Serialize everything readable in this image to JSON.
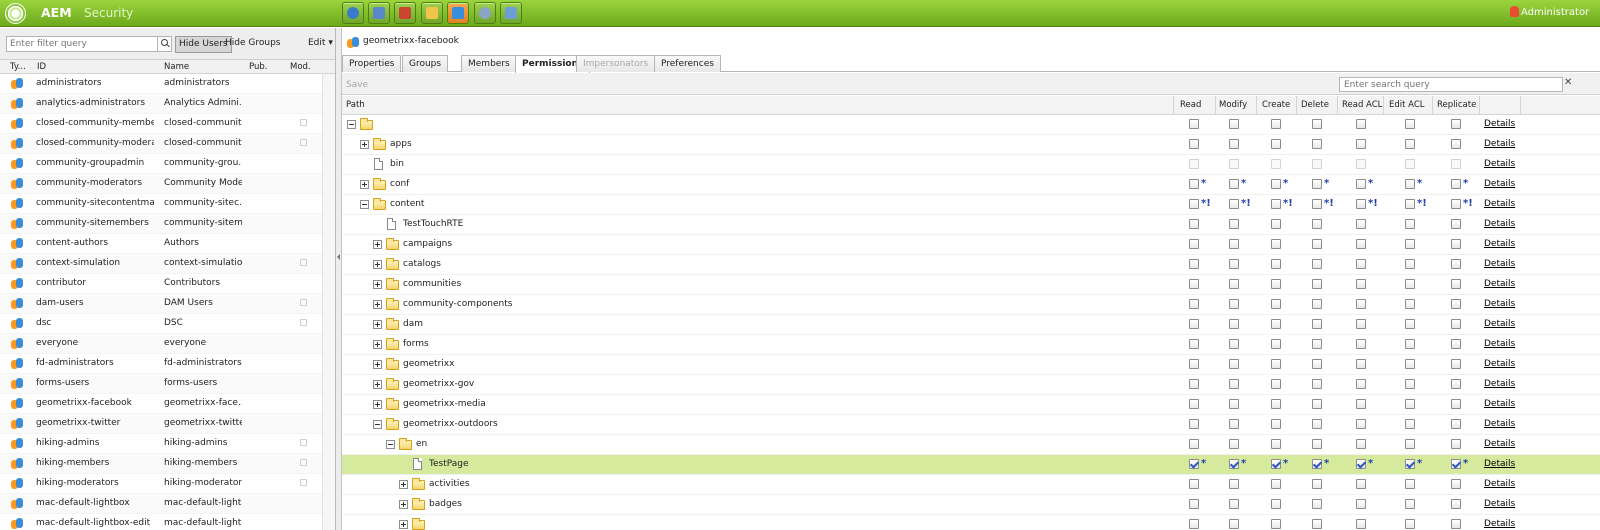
{
  "app": {
    "brand": "AEM",
    "section": "Security",
    "user": "Administrator"
  },
  "toolbar_icons": [
    "websites-icon",
    "digital-assets-icon",
    "campaigns-icon",
    "inbox-icon",
    "users-icon",
    "tools-icon",
    "tagging-icon"
  ],
  "left": {
    "filter_placeholder": "Enter filter query",
    "hide_users": "Hide Users",
    "hide_groups": "Hide Groups",
    "edit": "Edit",
    "columns": [
      "Ty...",
      "ID",
      "Name",
      "Pub.",
      "Mod."
    ],
    "rows": [
      {
        "id": "administrators",
        "name": "administrators",
        "mod": false
      },
      {
        "id": "analytics-administrators",
        "name": "Analytics Admini...",
        "mod": false
      },
      {
        "id": "closed-community-members",
        "name": "closed-communit...",
        "mod": true
      },
      {
        "id": "closed-community-moderat...",
        "name": "closed-communit...",
        "mod": true
      },
      {
        "id": "community-groupadmin",
        "name": "community-grou...",
        "mod": false
      },
      {
        "id": "community-moderators",
        "name": "Community Mode...",
        "mod": false
      },
      {
        "id": "community-sitecontentman...",
        "name": "community-sitec...",
        "mod": false
      },
      {
        "id": "community-sitemembers",
        "name": "community-sitem...",
        "mod": false
      },
      {
        "id": "content-authors",
        "name": "Authors",
        "mod": false
      },
      {
        "id": "context-simulation",
        "name": "context-simulation",
        "mod": true
      },
      {
        "id": "contributor",
        "name": "Contributors",
        "mod": false
      },
      {
        "id": "dam-users",
        "name": "DAM Users",
        "mod": true
      },
      {
        "id": "dsc",
        "name": "DSC",
        "mod": true
      },
      {
        "id": "everyone",
        "name": "everyone",
        "mod": false
      },
      {
        "id": "fd-administrators",
        "name": "fd-administrators",
        "mod": false
      },
      {
        "id": "forms-users",
        "name": "forms-users",
        "mod": false
      },
      {
        "id": "geometrixx-facebook",
        "name": "geometrixx-face...",
        "mod": false
      },
      {
        "id": "geometrixx-twitter",
        "name": "geometrixx-twitter",
        "mod": false
      },
      {
        "id": "hiking-admins",
        "name": "hiking-admins",
        "mod": true
      },
      {
        "id": "hiking-members",
        "name": "hiking-members",
        "mod": true
      },
      {
        "id": "hiking-moderators",
        "name": "hiking-moderators",
        "mod": true
      },
      {
        "id": "mac-default-lightbox",
        "name": "mac-default-light...",
        "mod": false
      },
      {
        "id": "mac-default-lightbox-edit",
        "name": "mac-default-light...",
        "mod": false
      }
    ]
  },
  "right": {
    "title": "geometrixx-facebook",
    "tabs": [
      {
        "label": "Properties",
        "state": "normal"
      },
      {
        "label": "Groups",
        "state": "normal"
      },
      {
        "label": "Members",
        "state": "normal"
      },
      {
        "label": "Permissions",
        "state": "active"
      },
      {
        "label": "Impersonators",
        "state": "disabled"
      },
      {
        "label": "Preferences",
        "state": "normal"
      }
    ],
    "save": "Save",
    "search_placeholder": "Enter search query",
    "search_close": "✕",
    "columns": [
      "Path",
      "Read",
      "Modify",
      "Create",
      "Delete",
      "Read ACL",
      "Edit ACL",
      "Replicate"
    ],
    "details": "Details",
    "rows": [
      {
        "name": "",
        "kind": "folder",
        "depth": 0,
        "exp": "minus",
        "perm": "none"
      },
      {
        "name": "apps",
        "kind": "folder",
        "depth": 1,
        "exp": "plus",
        "perm": "none"
      },
      {
        "name": "bin",
        "kind": "file",
        "depth": 1,
        "exp": "",
        "perm": "disabled"
      },
      {
        "name": "conf",
        "kind": "folder",
        "depth": 1,
        "exp": "plus",
        "perm": "star"
      },
      {
        "name": "content",
        "kind": "folder",
        "depth": 1,
        "exp": "minus",
        "perm": "starbang"
      },
      {
        "name": "TestTouchRTE",
        "kind": "file",
        "depth": 2,
        "exp": "",
        "perm": "none"
      },
      {
        "name": "campaigns",
        "kind": "folder",
        "depth": 2,
        "exp": "plus",
        "perm": "none"
      },
      {
        "name": "catalogs",
        "kind": "folder",
        "depth": 2,
        "exp": "plus",
        "perm": "none"
      },
      {
        "name": "communities",
        "kind": "folder",
        "depth": 2,
        "exp": "plus",
        "perm": "none"
      },
      {
        "name": "community-components",
        "kind": "folder",
        "depth": 2,
        "exp": "plus",
        "perm": "none"
      },
      {
        "name": "dam",
        "kind": "folder",
        "depth": 2,
        "exp": "plus",
        "perm": "none"
      },
      {
        "name": "forms",
        "kind": "folder",
        "depth": 2,
        "exp": "plus",
        "perm": "none"
      },
      {
        "name": "geometrixx",
        "kind": "folder",
        "depth": 2,
        "exp": "plus",
        "perm": "none"
      },
      {
        "name": "geometrixx-gov",
        "kind": "folder",
        "depth": 2,
        "exp": "plus",
        "perm": "none"
      },
      {
        "name": "geometrixx-media",
        "kind": "folder",
        "depth": 2,
        "exp": "plus",
        "perm": "none"
      },
      {
        "name": "geometrixx-outdoors",
        "kind": "folder",
        "depth": 2,
        "exp": "minus",
        "perm": "none"
      },
      {
        "name": "en",
        "kind": "folder",
        "depth": 3,
        "exp": "minus",
        "perm": "none"
      },
      {
        "name": "TestPage",
        "kind": "file",
        "depth": 4,
        "exp": "",
        "perm": "checked",
        "selected": true
      },
      {
        "name": "activities",
        "kind": "folder",
        "depth": 4,
        "exp": "plus",
        "perm": "none"
      },
      {
        "name": "badges",
        "kind": "folder",
        "depth": 4,
        "exp": "plus",
        "perm": "none"
      },
      {
        "name": "",
        "kind": "folder",
        "depth": 4,
        "exp": "plus",
        "perm": "none"
      }
    ]
  },
  "marks": {
    "star": "*",
    "starbang": "*!"
  }
}
